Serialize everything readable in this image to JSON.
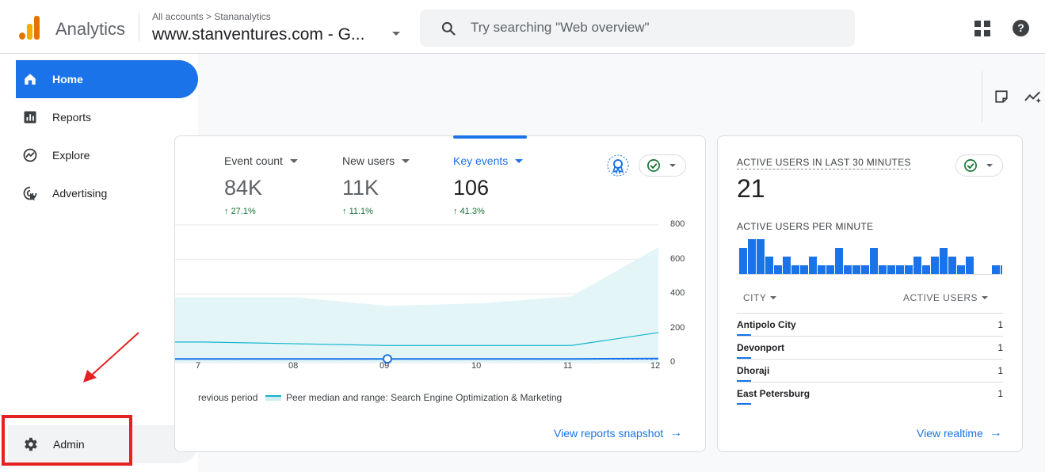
{
  "header": {
    "app_title": "Analytics",
    "breadcrumb": "All accounts > Stananalytics",
    "property_name": "www.stanventures.com - G...",
    "search_placeholder": "Try searching \"Web overview\""
  },
  "sidebar": {
    "items": [
      {
        "label": "Home",
        "icon": "home-icon",
        "active": true
      },
      {
        "label": "Reports",
        "icon": "reports-icon"
      },
      {
        "label": "Explore",
        "icon": "explore-icon"
      },
      {
        "label": "Advertising",
        "icon": "advertising-icon"
      }
    ],
    "admin_label": "Admin"
  },
  "metrics": [
    {
      "label": "Event count",
      "value": "84K",
      "change": "27.1%"
    },
    {
      "label": "New users",
      "value": "11K",
      "change": "11.1%"
    },
    {
      "label": "Key events",
      "value": "106",
      "change": "41.3%"
    }
  ],
  "chart_data": {
    "type": "line",
    "x": [
      "07",
      "08",
      "09",
      "10",
      "11",
      "12"
    ],
    "y_ticks": [
      "800",
      "600",
      "400",
      "200",
      "0"
    ],
    "ylim": [
      0,
      800
    ],
    "series": [
      {
        "name": "Key events",
        "values": [
          22,
          22,
          22,
          22,
          22,
          24
        ]
      },
      {
        "name": "Previous period",
        "values": [
          20,
          20,
          20,
          20,
          20,
          20
        ]
      },
      {
        "name": "Peer median and range: Search Engine Optimization & Marketing",
        "values": [
          120,
          110,
          100,
          100,
          100,
          175
        ]
      }
    ],
    "range_upper": [
      380,
      380,
      330,
      345,
      385,
      670
    ],
    "legend": [
      "revious period",
      "Peer median and range: Search Engine Optimization & Marketing"
    ]
  },
  "links": {
    "reports_snapshot": "View reports snapshot",
    "realtime": "View realtime"
  },
  "realtime": {
    "title": "ACTIVE USERS IN LAST 30 MINUTES",
    "value": "21",
    "per_minute_label": "ACTIVE USERS PER MINUTE",
    "per_minute": [
      3,
      4,
      4,
      2,
      1,
      2,
      1,
      1,
      2,
      1,
      1,
      3,
      1,
      1,
      1,
      3,
      1,
      1,
      1,
      1,
      2,
      1,
      2,
      3,
      2,
      1,
      2,
      0,
      0,
      1,
      1
    ],
    "col_city": "CITY",
    "col_users": "ACTIVE USERS",
    "rows": [
      {
        "city": "Antipolo City",
        "count": "1"
      },
      {
        "city": "Devonport",
        "count": "1"
      },
      {
        "city": "Dhoraji",
        "count": "1"
      },
      {
        "city": "East Petersburg",
        "count": "1"
      }
    ]
  },
  "colors": {
    "accent": "#1a73e8",
    "peer_line": "#12b5cb",
    "peer_fill": "#e4f5f7",
    "positive": "#137333",
    "annotation": "#e52222"
  }
}
